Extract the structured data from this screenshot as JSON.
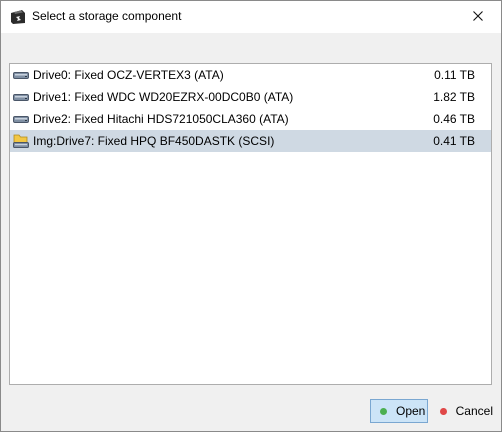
{
  "window": {
    "title": "Select a storage component",
    "close_glyph": "✕"
  },
  "list": {
    "items": [
      {
        "label": "Drive0: Fixed OCZ-VERTEX3 (ATA)",
        "size": "0.11 TB",
        "icon": "hard-drive-icon",
        "selected": false
      },
      {
        "label": "Drive1: Fixed WDC WD20EZRX-00DC0B0 (ATA)",
        "size": "1.82 TB",
        "icon": "hard-drive-icon",
        "selected": false
      },
      {
        "label": "Drive2: Fixed Hitachi HDS721050CLA360 (ATA)",
        "size": "0.46 TB",
        "icon": "hard-drive-icon",
        "selected": false
      },
      {
        "label": "Img:Drive7: Fixed HPQ BF450DASTK (SCSI)",
        "size": "0.41 TB",
        "icon": "disk-image-icon",
        "selected": true
      }
    ]
  },
  "buttons": {
    "open_label": "Open",
    "cancel_label": "Cancel",
    "open_color": "#4caf50",
    "cancel_color": "#e04848"
  },
  "colors": {
    "selection": "#cfd9e3",
    "open_button_bg": "#cce4f7",
    "open_button_border": "#7aa7d1"
  }
}
